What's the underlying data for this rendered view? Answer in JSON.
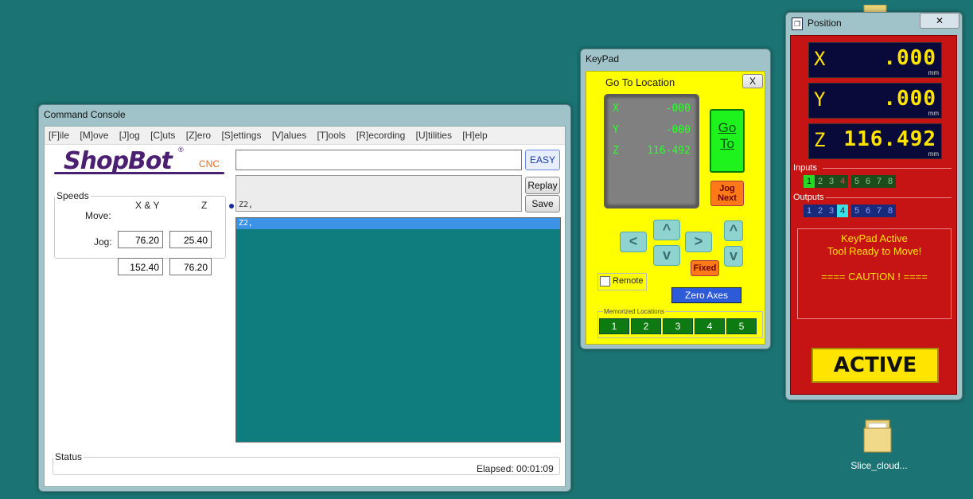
{
  "command_console": {
    "title": "Command Console",
    "menu": [
      "[F]ile",
      "[M]ove",
      "[J]og",
      "[C]uts",
      "[Z]ero",
      "[S]ettings",
      "[V]alues",
      "[T]ools",
      "[R]ecording",
      "[U]tilities",
      "[H]elp"
    ],
    "logo_text": "ShopBot",
    "logo_sub": "CNC",
    "logo_reg": "®",
    "speeds": {
      "legend": "Speeds",
      "col_xy": "X & Y",
      "col_z": "Z",
      "move_label": "Move:",
      "jog_label": "Jog:",
      "move_xy": "76.20",
      "move_z": "25.40",
      "jog_xy": "152.40",
      "jog_z": "76.20"
    },
    "command_input": "",
    "easy_button": "EASY",
    "replay_button": "Replay",
    "save_button": "Save",
    "history_text": "Z2,",
    "output_line": "Z2,",
    "status_legend": "Status",
    "elapsed": "Elapsed: 00:01:09"
  },
  "keypad": {
    "title": "KeyPad",
    "close": "X",
    "header": "Go To Location",
    "x_label": "X",
    "x_value": "-000",
    "y_label": "Y",
    "y_value": "-000",
    "z_label": "Z",
    "z_value": "116-492",
    "goto_line1": "Go",
    "goto_line2": "To",
    "jog_next_line1": "Jog",
    "jog_next_line2": "Next",
    "left": "<",
    "right": ">",
    "up": "^",
    "down": "v",
    "z_up": "^",
    "z_down": "v",
    "fixed": "Fixed",
    "remote": "Remote",
    "zero_axes": "Zero Axes",
    "memorized_label": "Memorized Locations",
    "memorized": [
      "1",
      "2",
      "3",
      "4",
      "5"
    ]
  },
  "position": {
    "title": "Position",
    "close": "✕",
    "x_label": "X",
    "x_value": ".000",
    "y_label": "Y",
    "y_value": ".000",
    "z_label": "Z",
    "z_value": "116.492",
    "unit": "mm",
    "inputs_label": "Inputs",
    "inputs": [
      "1",
      "2",
      "3",
      "4",
      "5",
      "6",
      "7",
      "8"
    ],
    "outputs_label": "Outputs",
    "outputs": [
      "1",
      "2",
      "3",
      "4",
      "5",
      "6",
      "7",
      "8"
    ],
    "message_1": "KeyPad Active",
    "message_2": "Tool Ready to Move!",
    "message_3": "==== CAUTION ! ====",
    "active": "ACTIVE"
  },
  "desktop": {
    "icon_label": "Slice_cloud..."
  }
}
